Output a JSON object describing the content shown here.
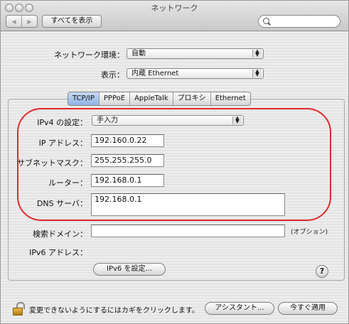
{
  "window": {
    "title": "ネットワーク"
  },
  "toolbar": {
    "back_icon": "◀",
    "forward_icon": "▶",
    "show_all_label": "すべてを表示",
    "search_placeholder": ""
  },
  "location": {
    "label": "ネットワーク環境：",
    "value": "自動"
  },
  "show": {
    "label": "表示：",
    "value": "内蔵 Ethernet"
  },
  "tabs": [
    {
      "label": "TCP/IP",
      "active": true
    },
    {
      "label": "PPPoE",
      "active": false
    },
    {
      "label": "AppleTalk",
      "active": false
    },
    {
      "label": "プロキシ",
      "active": false
    },
    {
      "label": "Ethernet",
      "active": false
    }
  ],
  "ipv4": {
    "label": "IPv4 の設定：",
    "value": "手入力"
  },
  "ip_address": {
    "label": "IP アドレス：",
    "value": "192.160.0.22"
  },
  "subnet": {
    "label": "サブネットマスク：",
    "value": "255.255.255.0"
  },
  "router": {
    "label": "ルーター：",
    "value": "192.168.0.1"
  },
  "dns": {
    "label": "DNS サーバ：",
    "value": "192.168.0.1"
  },
  "search_domains": {
    "label": "検索ドメイン：",
    "value": "",
    "optional": "(オプション)"
  },
  "ipv6": {
    "label": "IPv6 アドレス：",
    "button_label": "IPv6 を設定..."
  },
  "help_label": "?",
  "footer": {
    "lock_note": "変更できないようにするにはカギをクリックします。",
    "assistant_label": "アシスタント...",
    "apply_label": "今すぐ適用"
  },
  "colors": {
    "highlight_oval": "#e3282b",
    "active_tab": "#8fb2e6"
  }
}
